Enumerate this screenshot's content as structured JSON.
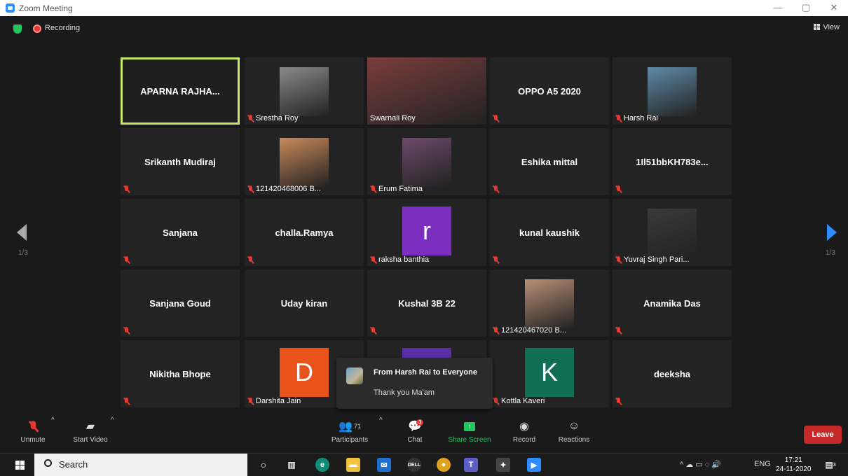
{
  "window": {
    "title": "Zoom Meeting",
    "min": "—",
    "max": "▢",
    "close": "✕"
  },
  "topbar": {
    "recording": "Recording",
    "view": "View"
  },
  "tiles": [
    {
      "name": "APARNA RAJHA...",
      "caption": "",
      "kind": "name",
      "active": true,
      "muted": false
    },
    {
      "name": "Srestha Roy",
      "caption": "Srestha Roy",
      "kind": "photo",
      "muted": true,
      "color": "#8a8a8a"
    },
    {
      "name": "Swarnali Roy",
      "caption": "Swarnali Roy",
      "kind": "video",
      "muted": false,
      "color": "#7a3d3d"
    },
    {
      "name": "OPPO A5 2020",
      "caption": "",
      "kind": "name",
      "muted": true
    },
    {
      "name": "Harsh Rai",
      "caption": "Harsh Rai",
      "kind": "photo",
      "muted": true,
      "color": "#5f8aa8"
    },
    {
      "name": "Srikanth Mudiraj",
      "caption": "",
      "kind": "name",
      "muted": true
    },
    {
      "name": "121420468006 B...",
      "caption": "121420468006 B...",
      "kind": "photo",
      "muted": true,
      "color": "#c98a5a"
    },
    {
      "name": "Erum Fatima",
      "caption": "Erum Fatima",
      "kind": "photo",
      "muted": true,
      "color": "#6d4a6a"
    },
    {
      "name": "Eshika mittal",
      "caption": "",
      "kind": "name",
      "muted": true
    },
    {
      "name": "1Il51bbKH783e...",
      "caption": "",
      "kind": "name",
      "muted": true
    },
    {
      "name": "Sanjana",
      "caption": "",
      "kind": "name",
      "muted": true
    },
    {
      "name": "challa.Ramya",
      "caption": "",
      "kind": "name",
      "muted": true
    },
    {
      "name": "raksha banthia",
      "caption": "raksha banthia",
      "kind": "letter",
      "letter": "r",
      "muted": true,
      "color": "#7b2fbe"
    },
    {
      "name": "kunal kaushik",
      "caption": "",
      "kind": "name",
      "muted": true
    },
    {
      "name": "Yuvraj Singh Pari...",
      "caption": "Yuvraj Singh Pari...",
      "kind": "photo",
      "muted": true,
      "color": "#3a3a3a"
    },
    {
      "name": "Sanjana Goud",
      "caption": "",
      "kind": "name",
      "muted": true
    },
    {
      "name": "Uday kiran",
      "caption": "",
      "kind": "name",
      "muted": false
    },
    {
      "name": "Kushal 3B 22",
      "caption": "",
      "kind": "name",
      "muted": true
    },
    {
      "name": "121420467020 B...",
      "caption": "121420467020 B...",
      "kind": "photo",
      "muted": true,
      "color": "#b98f76"
    },
    {
      "name": "Anamika Das",
      "caption": "",
      "kind": "name",
      "muted": true
    },
    {
      "name": "Nikitha Bhope",
      "caption": "",
      "kind": "name",
      "muted": true
    },
    {
      "name": "Darshita Jain",
      "caption": "Darshita Jain",
      "kind": "letter",
      "letter": "D",
      "muted": true,
      "color": "#e8541b"
    },
    {
      "name": "",
      "caption": "",
      "kind": "letter",
      "letter": "",
      "muted": false,
      "color": "#5a2fa8"
    },
    {
      "name": "Kottla Kaveri",
      "caption": "Kottla Kaveri",
      "kind": "letter",
      "letter": "K",
      "muted": true,
      "color": "#0f6e55"
    },
    {
      "name": "deeksha",
      "caption": "",
      "kind": "name",
      "muted": true
    }
  ],
  "pager": {
    "left": "1/3",
    "right": "1/3"
  },
  "chat_popup": {
    "from": "From Harsh Rai to Everyone",
    "message": "Thank you Ma'am"
  },
  "toolbar": {
    "unmute": "Unmute",
    "start_video": "Start Video",
    "participants": "Participants",
    "participants_count": "71",
    "chat": "Chat",
    "chat_badge": "3",
    "share": "Share Screen",
    "record": "Record",
    "reactions": "Reactions",
    "leave": "Leave"
  },
  "taskbar": {
    "search": "Search",
    "lang": "ENG",
    "time": "17:21",
    "date": "24-11-2020",
    "notif": "3"
  }
}
